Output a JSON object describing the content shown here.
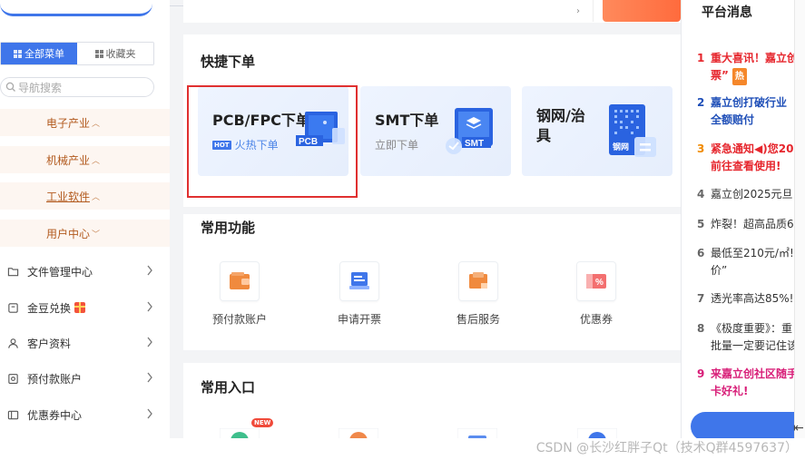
{
  "sidebar": {
    "tabs": [
      {
        "label": "全部菜单",
        "active": true
      },
      {
        "label": "收藏夹",
        "active": false
      }
    ],
    "search_placeholder": "导航搜索",
    "categories": [
      {
        "label": "电子产业",
        "chevron": "up"
      },
      {
        "label": "机械产业",
        "chevron": "up"
      },
      {
        "label": "工业软件",
        "chevron": "up"
      },
      {
        "label": "用户中心",
        "chevron": "down"
      }
    ],
    "items": [
      {
        "label": "文件管理中心",
        "icon": "folder-icon"
      },
      {
        "label": "金豆兑换",
        "icon": "box-icon"
      },
      {
        "label": "客户资料",
        "icon": "user-icon"
      },
      {
        "label": "预付款账户",
        "icon": "wallet-icon"
      },
      {
        "label": "优惠券中心",
        "icon": "coupon-icon"
      }
    ]
  },
  "quick_order": {
    "title": "快捷下单",
    "tiles": [
      {
        "title": "PCB/FPC下单",
        "tag": "HOT",
        "subtitle": "火热下单",
        "badge": "PCB"
      },
      {
        "title": "SMT下单",
        "subtitle": "立即下单",
        "badge": "SMT"
      },
      {
        "title": "钢网/治具",
        "badge": "钢网"
      }
    ]
  },
  "functions": {
    "title": "常用功能",
    "items": [
      {
        "label": "预付款账户",
        "icon": "wallet-icon",
        "color": "#f0782e"
      },
      {
        "label": "申请开票",
        "icon": "invoice-icon",
        "color": "#3f76ea"
      },
      {
        "label": "售后服务",
        "icon": "service-icon",
        "color": "#f0782e"
      },
      {
        "label": "优惠券",
        "icon": "coupon-icon",
        "color": "#f04a4a"
      }
    ]
  },
  "entry": {
    "title": "常用入口",
    "new_badge": "NEW"
  },
  "notices": {
    "title": "平台消息",
    "items": [
      {
        "num": "1",
        "text": "重大喜讯！嘉立创",
        "text2": "票”",
        "hot": "热",
        "style": "red"
      },
      {
        "num": "2",
        "text": "嘉立创打破行业",
        "text2": "全额赔付",
        "style": "blue"
      },
      {
        "num": "3",
        "text": "紧急通知◀)您20",
        "text2": "前往查看使用!",
        "style": "orange"
      },
      {
        "num": "4",
        "text": "嘉立创2025元旦",
        "style": "grey"
      },
      {
        "num": "5",
        "text": "炸裂！超高品质6",
        "style": "grey"
      },
      {
        "num": "6",
        "text": "最低至210元/㎡!",
        "text2": "价”",
        "style": "grey"
      },
      {
        "num": "7",
        "text": "透光率高达85%!",
        "style": "grey"
      },
      {
        "num": "8",
        "text": "《极度重要》：重",
        "text2": "批量一定要记住该",
        "style": "grey"
      },
      {
        "num": "9",
        "text": "来嘉立创社区随手",
        "text2": "卡好礼!",
        "style": "pink"
      }
    ]
  },
  "watermark": "CSDN @长沙红胖子Qt（技术Q群4597637）",
  "colors": {
    "primary": "#3f76ea",
    "accent": "#f0782e",
    "highlight": "#e03030"
  }
}
